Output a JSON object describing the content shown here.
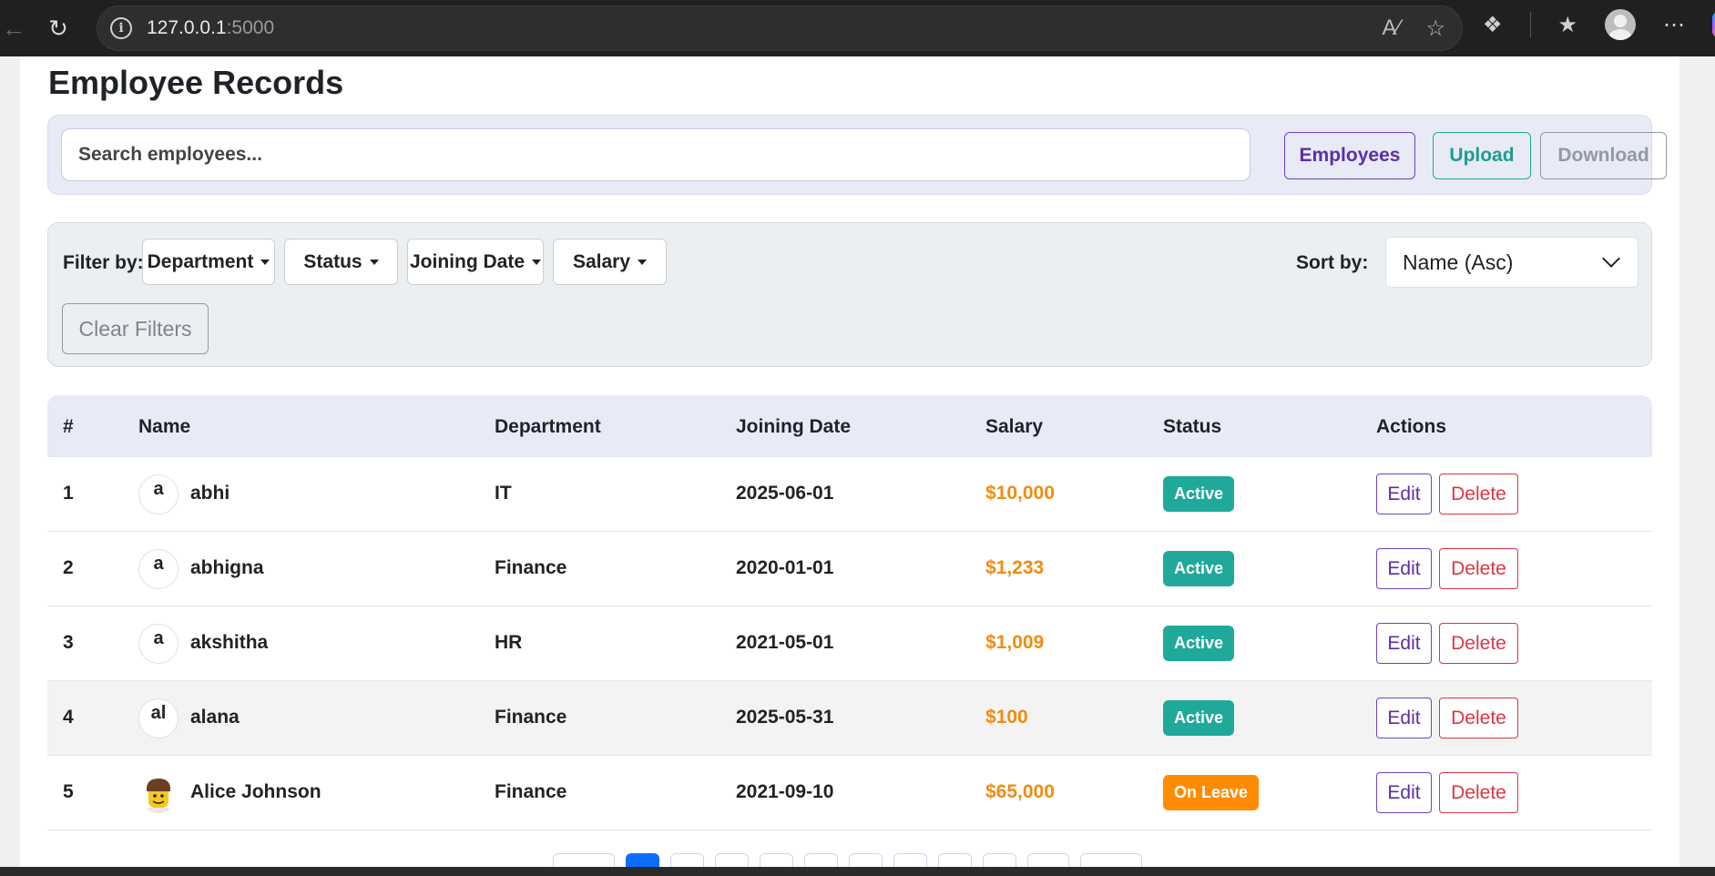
{
  "browser": {
    "url_host": "127.0.0.1",
    "url_port": ":5000"
  },
  "page": {
    "title": "Employee Records"
  },
  "search": {
    "placeholder": "Search employees...",
    "buttons": {
      "employees": "Employees",
      "upload": "Upload",
      "download": "Download"
    }
  },
  "filters": {
    "label": "Filter by:",
    "department": "Department",
    "status": "Status",
    "joining_date": "Joining Date",
    "salary": "Salary",
    "clear": "Clear Filters",
    "sort_label": "Sort by:",
    "sort_value": "Name (Asc)"
  },
  "table": {
    "headers": {
      "num": "#",
      "name": "Name",
      "department": "Department",
      "joining_date": "Joining Date",
      "salary": "Salary",
      "status": "Status",
      "actions": "Actions"
    },
    "rows": [
      {
        "num": "1",
        "avatar_alt": "a",
        "name": "abhi",
        "department": "IT",
        "joining_date": "2025-06-01",
        "salary": "$10,000",
        "status": "Active",
        "edit": "Edit",
        "delete": "Delete"
      },
      {
        "num": "2",
        "avatar_alt": "a",
        "name": "abhigna",
        "department": "Finance",
        "joining_date": "2020-01-01",
        "salary": "$1,233",
        "status": "Active",
        "edit": "Edit",
        "delete": "Delete"
      },
      {
        "num": "3",
        "avatar_alt": "a",
        "name": "akshitha",
        "department": "HR",
        "joining_date": "2021-05-01",
        "salary": "$1,009",
        "status": "Active",
        "edit": "Edit",
        "delete": "Delete"
      },
      {
        "num": "4",
        "avatar_alt": "al",
        "name": "alana",
        "department": "Finance",
        "joining_date": "2025-05-31",
        "salary": "$100",
        "status": "Active",
        "edit": "Edit",
        "delete": "Delete"
      },
      {
        "num": "5",
        "avatar_alt": "",
        "name": "Alice Johnson",
        "department": "Finance",
        "joining_date": "2021-09-10",
        "salary": "$65,000",
        "status": "On Leave",
        "edit": "Edit",
        "delete": "Delete"
      }
    ]
  },
  "colors": {
    "accent_purple": "#6f42c1",
    "teal": "#20a99a",
    "orange": "#ff8c00",
    "salary": "#f18c11",
    "danger": "#dc3545",
    "pager_current": "#0d6efd"
  }
}
